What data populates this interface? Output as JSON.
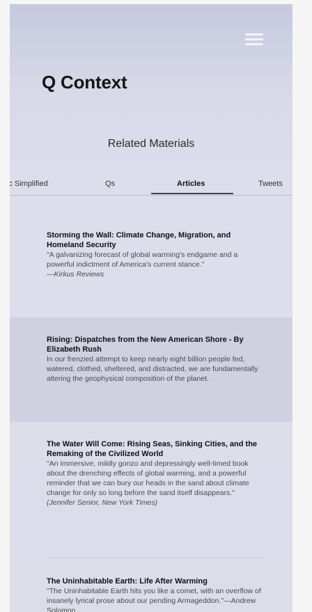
{
  "header": {
    "title": "Q Context",
    "menu_icon": "hamburger-menu-icon"
  },
  "section": {
    "title": "Related Materials"
  },
  "tabs": [
    {
      "label": "ic Simplified",
      "active": false
    },
    {
      "label": "Qs",
      "active": false
    },
    {
      "label": "Articles",
      "active": true
    },
    {
      "label": "Tweets",
      "active": false
    }
  ],
  "articles": [
    {
      "title": "Storming the Wall: Climate Change, Migration, and Homeland Security",
      "body": "\"A galvanizing forecast of global warming's endgame and a powerful indictment of America's current stance.\"",
      "citation": "—Kirkus Reviews"
    },
    {
      "title": "Rising: Dispatches from the New American Shore - By Elizabeth Rush",
      "body": "In our frenzied attempt to keep nearly eight billion people fed, watered, clothed, sheltered, and distracted, we are fundamentally altering the geophysical composition of the planet.",
      "citation": ""
    },
    {
      "title": "The Water Will Come: Rising Seas, Sinking Cities, and the Remaking of the Civilized World",
      "body": "\"An immersive, mildly gonzo and depressingly well-timed book about the drenching effects of global warming, and a powerful reminder that we can bury our heads in the sand about climate change for only so long before the sand itself disappears.\"",
      "citation": "(Jennifer Senior, New York Times)"
    },
    {
      "title": "The Uninhabitable Earth: Life After Warming",
      "body": "\"The Uninhabitable Earth hits you like a comet, with an overflow of insanely lyrical prose about our pending Armageddon.\"—Andrew Solomon",
      "citation": ""
    }
  ],
  "colors": {
    "header_gradient_top": "#c6c9de",
    "background": "#dddeec",
    "highlight_row": "#cfd1e1",
    "tab_indicator": "#3b3d52"
  }
}
